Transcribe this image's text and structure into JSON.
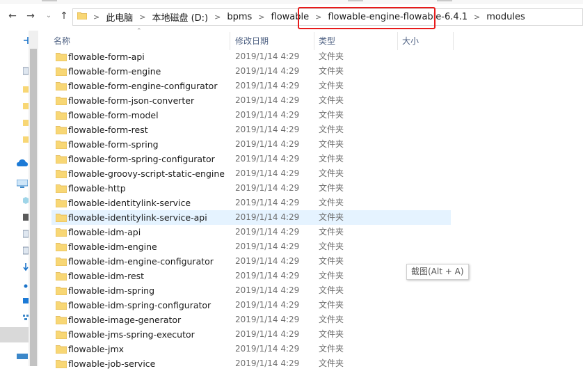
{
  "header": {
    "columns": {
      "name": "名称",
      "date": "修改日期",
      "type": "类型",
      "size": "大小"
    }
  },
  "breadcrumb": [
    "此电脑",
    "本地磁盘 (D:)",
    "bpms",
    "flowable",
    "flowable-engine-flowable-6.4.1",
    "modules"
  ],
  "highlight_color": "#e81b1b",
  "selection_color": "#e5f3ff",
  "folder_color": "#f8d775",
  "tooltip": {
    "text": "截图(Alt + A)"
  },
  "files": [
    {
      "name": "flowable-form-api",
      "date": "2019/1/14 4:29",
      "type": "文件夹"
    },
    {
      "name": "flowable-form-engine",
      "date": "2019/1/14 4:29",
      "type": "文件夹"
    },
    {
      "name": "flowable-form-engine-configurator",
      "date": "2019/1/14 4:29",
      "type": "文件夹"
    },
    {
      "name": "flowable-form-json-converter",
      "date": "2019/1/14 4:29",
      "type": "文件夹"
    },
    {
      "name": "flowable-form-model",
      "date": "2019/1/14 4:29",
      "type": "文件夹"
    },
    {
      "name": "flowable-form-rest",
      "date": "2019/1/14 4:29",
      "type": "文件夹"
    },
    {
      "name": "flowable-form-spring",
      "date": "2019/1/14 4:29",
      "type": "文件夹"
    },
    {
      "name": "flowable-form-spring-configurator",
      "date": "2019/1/14 4:29",
      "type": "文件夹"
    },
    {
      "name": "flowable-groovy-script-static-engine",
      "date": "2019/1/14 4:29",
      "type": "文件夹"
    },
    {
      "name": "flowable-http",
      "date": "2019/1/14 4:29",
      "type": "文件夹"
    },
    {
      "name": "flowable-identitylink-service",
      "date": "2019/1/14 4:29",
      "type": "文件夹"
    },
    {
      "name": "flowable-identitylink-service-api",
      "date": "2019/1/14 4:29",
      "type": "文件夹"
    },
    {
      "name": "flowable-idm-api",
      "date": "2019/1/14 4:29",
      "type": "文件夹"
    },
    {
      "name": "flowable-idm-engine",
      "date": "2019/1/14 4:29",
      "type": "文件夹"
    },
    {
      "name": "flowable-idm-engine-configurator",
      "date": "2019/1/14 4:29",
      "type": "文件夹"
    },
    {
      "name": "flowable-idm-rest",
      "date": "2019/1/14 4:29",
      "type": "文件夹"
    },
    {
      "name": "flowable-idm-spring",
      "date": "2019/1/14 4:29",
      "type": "文件夹"
    },
    {
      "name": "flowable-idm-spring-configurator",
      "date": "2019/1/14 4:29",
      "type": "文件夹"
    },
    {
      "name": "flowable-image-generator",
      "date": "2019/1/14 4:29",
      "type": "文件夹"
    },
    {
      "name": "flowable-jms-spring-executor",
      "date": "2019/1/14 4:29",
      "type": "文件夹"
    },
    {
      "name": "flowable-jmx",
      "date": "2019/1/14 4:29",
      "type": "文件夹"
    },
    {
      "name": "flowable-job-service",
      "date": "2019/1/14 4:29",
      "type": "文件夹"
    }
  ]
}
